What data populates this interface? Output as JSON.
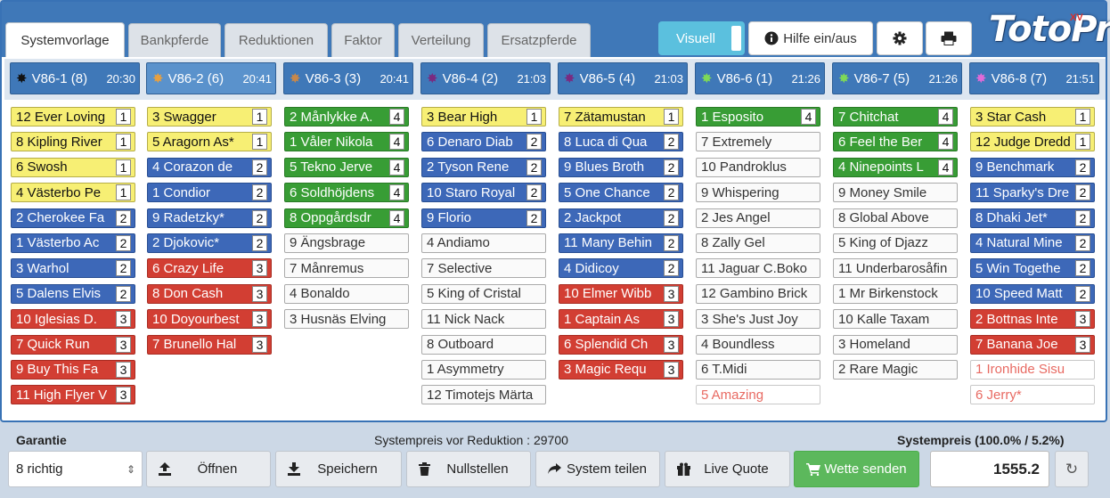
{
  "tabs": [
    {
      "label": "Systemvorlage",
      "active": true
    },
    {
      "label": "Bankpferde"
    },
    {
      "label": "Reduktionen"
    },
    {
      "label": "Faktor"
    },
    {
      "label": "Verteilung"
    },
    {
      "label": "Ersatzpferde"
    }
  ],
  "toolbar": {
    "visuell_label": "Visuell",
    "help_label": "Hilfe ein/aus",
    "help_icon": "info-circle-icon",
    "settings_icon": "gear-icon",
    "print_icon": "print-icon"
  },
  "logo": {
    "text": "TotoPro",
    "badge": "XV"
  },
  "races": [
    {
      "name": "V86-1 (8)",
      "time": "20:30",
      "dot_color": "#111111",
      "horses": [
        {
          "name": "12 Ever Loving",
          "count": "1",
          "color": "yellow"
        },
        {
          "name": "8 Kipling River",
          "count": "1",
          "color": "yellow"
        },
        {
          "name": "6 Swosh",
          "count": "1",
          "color": "yellow"
        },
        {
          "name": "4 Västerbo Pe",
          "count": "1",
          "color": "yellow"
        },
        {
          "name": "2 Cherokee Fa",
          "count": "2",
          "color": "blue"
        },
        {
          "name": "1 Västerbo Ac",
          "count": "2",
          "color": "blue"
        },
        {
          "name": "3 Warhol",
          "count": "2",
          "color": "blue"
        },
        {
          "name": "5 Dalens Elvis",
          "count": "2",
          "color": "blue"
        },
        {
          "name": "10 Iglesias D.",
          "count": "3",
          "color": "red"
        },
        {
          "name": "7 Quick Run",
          "count": "3",
          "color": "red"
        },
        {
          "name": "9 Buy This Fa",
          "count": "3",
          "color": "red"
        },
        {
          "name": "11 High Flyer V",
          "count": "3",
          "color": "red"
        }
      ]
    },
    {
      "name": "V86-2 (6)",
      "time": "20:41",
      "dot_color": "#e8a040",
      "active": true,
      "horses": [
        {
          "name": "3 Swagger",
          "count": "1",
          "color": "yellow"
        },
        {
          "name": "5 Aragorn As*",
          "count": "1",
          "color": "yellow"
        },
        {
          "name": "4 Corazon de",
          "count": "2",
          "color": "blue"
        },
        {
          "name": "1 Condior",
          "count": "2",
          "color": "blue"
        },
        {
          "name": "9 Radetzky*",
          "count": "2",
          "color": "blue"
        },
        {
          "name": "2 Djokovic*",
          "count": "2",
          "color": "blue"
        },
        {
          "name": "6 Crazy Life",
          "count": "3",
          "color": "red"
        },
        {
          "name": "8 Don Cash",
          "count": "3",
          "color": "red"
        },
        {
          "name": "10 Doyourbest",
          "count": "3",
          "color": "red"
        },
        {
          "name": "7 Brunello Hal",
          "count": "3",
          "color": "red"
        }
      ]
    },
    {
      "name": "V86-3 (3)",
      "time": "20:41",
      "dot_color": "#c8884a",
      "horses": [
        {
          "name": "2 Månlykke A.",
          "count": "4",
          "color": "green"
        },
        {
          "name": "1 Våler Nikola",
          "count": "4",
          "color": "green"
        },
        {
          "name": "5 Tekno Jerve",
          "count": "4",
          "color": "green"
        },
        {
          "name": "6 Soldhöjdens",
          "count": "4",
          "color": "green"
        },
        {
          "name": "8 Oppgårdsdr",
          "count": "4",
          "color": "green"
        },
        {
          "name": "9 Ängsbrage",
          "count": "",
          "color": "white"
        },
        {
          "name": "7 Månremus",
          "count": "",
          "color": "white"
        },
        {
          "name": "4 Bonaldo",
          "count": "",
          "color": "white"
        },
        {
          "name": "3 Husnäs Elving",
          "count": "",
          "color": "white"
        }
      ]
    },
    {
      "name": "V86-4 (2)",
      "time": "21:03",
      "dot_color": "#7a2a80",
      "horses": [
        {
          "name": "3 Bear High",
          "count": "1",
          "color": "yellow"
        },
        {
          "name": "6 Denaro Diab",
          "count": "2",
          "color": "blue"
        },
        {
          "name": "2 Tyson Rene",
          "count": "2",
          "color": "blue"
        },
        {
          "name": "10 Staro Royal",
          "count": "2",
          "color": "blue"
        },
        {
          "name": "9 Florio",
          "count": "2",
          "color": "blue"
        },
        {
          "name": "4 Andiamo",
          "count": "",
          "color": "white"
        },
        {
          "name": "7 Selective",
          "count": "",
          "color": "white"
        },
        {
          "name": "5 King of Cristal",
          "count": "",
          "color": "white"
        },
        {
          "name": "11 Nick Nack",
          "count": "",
          "color": "white"
        },
        {
          "name": "8 Outboard",
          "count": "",
          "color": "white"
        },
        {
          "name": "1 Asymmetry",
          "count": "",
          "color": "white"
        },
        {
          "name": "12 Timotejs Märta",
          "count": "",
          "color": "white"
        }
      ]
    },
    {
      "name": "V86-5 (4)",
      "time": "21:03",
      "dot_color": "#7a2a80",
      "horses": [
        {
          "name": "7 Zätamustan",
          "count": "1",
          "color": "yellow"
        },
        {
          "name": "8 Luca di Qua",
          "count": "2",
          "color": "blue"
        },
        {
          "name": "9 Blues Broth",
          "count": "2",
          "color": "blue"
        },
        {
          "name": "5 One Chance",
          "count": "2",
          "color": "blue"
        },
        {
          "name": "2 Jackpot",
          "count": "2",
          "color": "blue"
        },
        {
          "name": "11 Many Behin",
          "count": "2",
          "color": "blue"
        },
        {
          "name": "4 Didicoy",
          "count": "2",
          "color": "blue"
        },
        {
          "name": "10 Elmer Wibb",
          "count": "3",
          "color": "red"
        },
        {
          "name": "1 Captain As",
          "count": "3",
          "color": "red"
        },
        {
          "name": "6 Splendid Ch",
          "count": "3",
          "color": "red"
        },
        {
          "name": "3 Magic Requ",
          "count": "3",
          "color": "red"
        }
      ]
    },
    {
      "name": "V86-6 (1)",
      "time": "21:26",
      "dot_color": "#7ed957",
      "horses": [
        {
          "name": "1 Esposito",
          "count": "4",
          "color": "green"
        },
        {
          "name": "7 Extremely",
          "count": "",
          "color": "white"
        },
        {
          "name": "10 Pandroklus",
          "count": "",
          "color": "white"
        },
        {
          "name": "9 Whispering",
          "count": "",
          "color": "white"
        },
        {
          "name": "2 Jes Angel",
          "count": "",
          "color": "white"
        },
        {
          "name": "8 Zally Gel",
          "count": "",
          "color": "white"
        },
        {
          "name": "11 Jaguar C.Boko",
          "count": "",
          "color": "white"
        },
        {
          "name": "12 Gambino Brick",
          "count": "",
          "color": "white"
        },
        {
          "name": "3 She's Just Joy",
          "count": "",
          "color": "white"
        },
        {
          "name": "4 Boundless",
          "count": "",
          "color": "white"
        },
        {
          "name": "6 T.Midi",
          "count": "",
          "color": "white"
        },
        {
          "name": "5 Amazing",
          "count": "",
          "color": "scratched"
        }
      ]
    },
    {
      "name": "V86-7 (5)",
      "time": "21:26",
      "dot_color": "#7ed957",
      "horses": [
        {
          "name": "7 Chitchat",
          "count": "4",
          "color": "green"
        },
        {
          "name": "6 Feel the Ber",
          "count": "4",
          "color": "green"
        },
        {
          "name": "4 Ninepoints L",
          "count": "4",
          "color": "green"
        },
        {
          "name": "9 Money Smile",
          "count": "",
          "color": "white"
        },
        {
          "name": "8 Global Above",
          "count": "",
          "color": "white"
        },
        {
          "name": "5 King of Djazz",
          "count": "",
          "color": "white"
        },
        {
          "name": "11 Underbarosåfin",
          "count": "",
          "color": "white"
        },
        {
          "name": "1 Mr Birkenstock",
          "count": "",
          "color": "white"
        },
        {
          "name": "10 Kalle Taxam",
          "count": "",
          "color": "white"
        },
        {
          "name": "3 Homeland",
          "count": "",
          "color": "white"
        },
        {
          "name": "2 Rare Magic",
          "count": "",
          "color": "white"
        }
      ]
    },
    {
      "name": "V86-8 (7)",
      "time": "21:51",
      "dot_color": "#e06ad8",
      "horses": [
        {
          "name": "3 Star Cash",
          "count": "1",
          "color": "yellow"
        },
        {
          "name": "12 Judge Dredd",
          "count": "1",
          "color": "yellow"
        },
        {
          "name": "9 Benchmark",
          "count": "2",
          "color": "blue"
        },
        {
          "name": "11 Sparky's Dre",
          "count": "2",
          "color": "blue"
        },
        {
          "name": "8 Dhaki Jet*",
          "count": "2",
          "color": "blue"
        },
        {
          "name": "4 Natural Mine",
          "count": "2",
          "color": "blue"
        },
        {
          "name": "5 Win Togethe",
          "count": "2",
          "color": "blue"
        },
        {
          "name": "10 Speed Matt",
          "count": "2",
          "color": "blue"
        },
        {
          "name": "2 Bottnas Inte",
          "count": "3",
          "color": "red"
        },
        {
          "name": "7 Banana Joe",
          "count": "3",
          "color": "red"
        },
        {
          "name": "1 Ironhide Sisu",
          "count": "",
          "color": "scratched"
        },
        {
          "name": "6 Jerry*",
          "count": "",
          "color": "scratched"
        }
      ]
    }
  ],
  "footer": {
    "garantie_label": "Garantie",
    "garantie_value": "8 richtig",
    "preis_vor_label": "Systempreis vor Reduktion : 29700",
    "preis_label": "Systempreis (100.0% / 5.2%)",
    "price_value": "1555.2",
    "buttons": [
      {
        "label": "Öffnen",
        "icon": "upload-icon"
      },
      {
        "label": "Speichern",
        "icon": "download-icon"
      },
      {
        "label": "Nullstellen",
        "icon": "trash-icon"
      },
      {
        "label": "System teilen",
        "icon": "share-arrow-icon"
      },
      {
        "label": "Live Quote",
        "icon": "gift-icon"
      },
      {
        "label": "Wette senden",
        "icon": "cart-icon"
      }
    ]
  }
}
